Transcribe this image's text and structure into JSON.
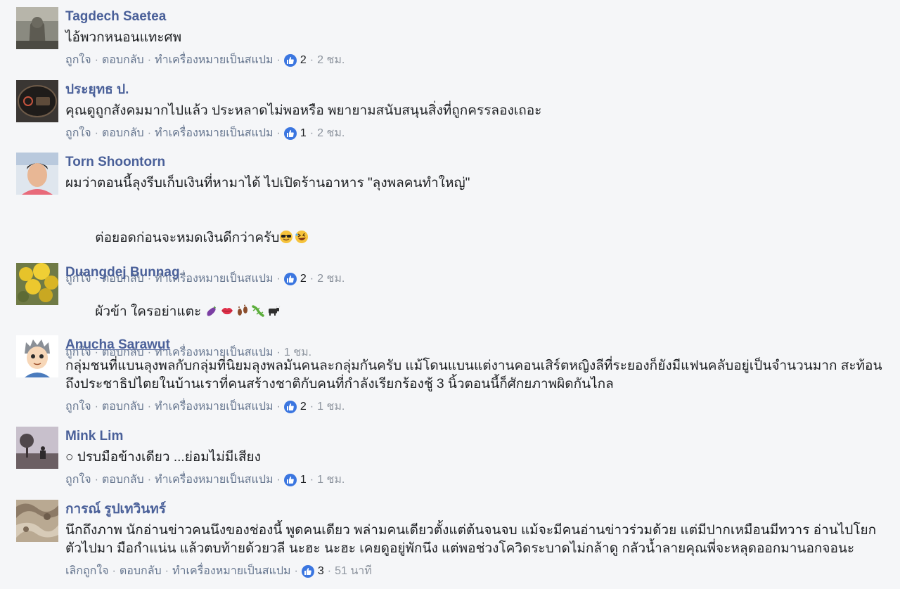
{
  "colors": {
    "background": "#f5f6f8",
    "name": "#4a6099",
    "text": "#1c1e21",
    "meta": "#7b8794",
    "like_badge": "#3b76e0"
  },
  "comments": [
    {
      "author": "Tagdech Saetea",
      "text": "ไอ้พวกหนอนแทะศพ",
      "actions": {
        "like": "ถูกใจ",
        "reply": "ตอบกลับ",
        "spam": "ทำเครื่องหมายเป็นสแปม"
      },
      "like_count": "2",
      "time": "2 ชม.",
      "avatar_icon": "stone-statue-photo"
    },
    {
      "author": "ประยุทธ ป.",
      "text": "คุณดูถูกสังคมมากไปแล้ว ประหลาดไม่พอหรือ พยายามสนับสนุนสิ่งที่ถูกครรลองเถอะ",
      "actions": {
        "like": "ถูกใจ",
        "reply": "ตอบกลับ",
        "spam": "ทำเครื่องหมายเป็นสแปม"
      },
      "like_count": "1",
      "time": "2 ชม.",
      "avatar_icon": "dark-emblem-photo"
    },
    {
      "author": "Torn Shoontorn",
      "text": "ผมว่าตอนนี้ลุงรีบเก็บเงินที่หามาได้ ไปเปิดร้านอาหาร \"ลุงพลคนทำใหญ่\"",
      "text2": "ต่อยอดก่อนจะหมดเงินดีกว่าครับ",
      "emojis": [
        "sunglasses-face-emoji",
        "rolling-laughing-emoji"
      ],
      "actions": {
        "like": "ถูกใจ",
        "reply": "ตอบกลับ",
        "spam": "ทำเครื่องหมายเป็นสแปม"
      },
      "like_count": "2",
      "time": "2 ชม.",
      "avatar_icon": "man-portrait-photo"
    },
    {
      "author": "Duangdej Bunnag",
      "text": "ผัวข้า ใครอย่าแตะ ",
      "emojis": [
        "eggplant-emoji",
        "kiss-lips-emoji",
        "footprints-emoji",
        "lizard-emoji",
        "ox-emoji"
      ],
      "actions": {
        "like": "ถูกใจ",
        "reply": "ตอบกลับ",
        "spam": "ทำเครื่องหมายเป็นสแปม"
      },
      "time": "1 ชม.",
      "avatar_icon": "yellow-flowers-photo"
    },
    {
      "author": "Anucha Sarawut",
      "text": "กลุ่มชนที่แบนลุงพลกับกลุ่มที่นิยมลุงพลมันคนละกลุ่มกันครับ แม้โดนแบนแต่งานคอนเสิร์ตหญิงลีที่ระยองก็ยังมีแฟนคลับอยู่เป็นจำนวนมาก สะท้อน\nถึงประชาธิปไตยในบ้านเราที่คนสร้างชาติกับคนที่กำลังเรียกร้องชู้ 3 นิ้วตอนนี้ก็ศักยภาพผิดกันไกล",
      "actions": {
        "like": "ถูกใจ",
        "reply": "ตอบกลับ",
        "spam": "ทำเครื่องหมายเป็นสแปม"
      },
      "like_count": "2",
      "time": "1 ชม.",
      "avatar_icon": "cartoon-avatar"
    },
    {
      "author": "Mink Lim",
      "text": "○ ปรบมือข้างเดียว ...ย่อมไม่มีเสียง",
      "actions": {
        "like": "ถูกใจ",
        "reply": "ตอบกลับ",
        "spam": "ทำเครื่องหมายเป็นสแปม"
      },
      "like_count": "1",
      "time": "1 ชม.",
      "avatar_icon": "tree-landscape-photo"
    },
    {
      "author": "การณ์ รูปเทวินทร์",
      "text": "นึกถึงภาพ นักอ่านข่าวคนนึงของช่องนี้ พูดคนเดียว พล่ามคนเดียวตั้งแต่ต้นจนจบ แม้จะมีคนอ่านข่าวร่วมด้วย แต่มีปากเหมือนมีทวาร อ่านไปโยก\nตัวไปมา มือกำแน่น แล้วตบท้ายด้วยวลี นะฮะ นะฮะ เคยดูอยู่พักนึง แต่พอช่วงโควิดระบาดไม่กล้าดู กลัวน้ำลายคุณพี่จะหลุดออกมานอกจอนะ",
      "actions": {
        "like": "เลิกถูกใจ",
        "reply": "ตอบกลับ",
        "spam": "ทำเครื่องหมายเป็นสแปม"
      },
      "like_count": "3",
      "time": "51 นาที",
      "avatar_icon": "fabric-pattern-photo"
    }
  ]
}
